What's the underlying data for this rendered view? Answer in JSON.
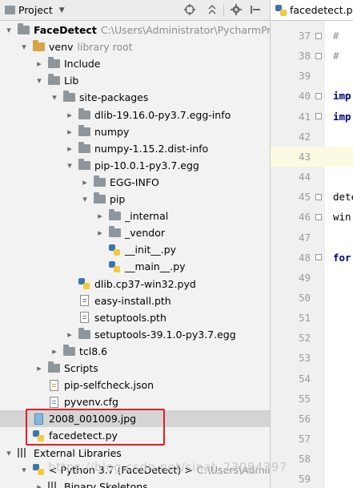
{
  "project_toolbar": {
    "title": "Project",
    "dropdown_glyph": "▼",
    "icons": [
      "target-icon",
      "collapse-all-icon",
      "gear-icon",
      "hide-icon"
    ]
  },
  "tree": [
    {
      "label": "FaceDetect",
      "hint": "C:\\Users\\Administrator\\PycharmProjects",
      "arrow": "▾",
      "icon": "folder",
      "bold": true
    },
    {
      "label": "venv",
      "hint": "library root",
      "arrow": "▾",
      "icon": "folder-lib"
    },
    {
      "label": "Include",
      "hint": "",
      "arrow": "▸",
      "icon": "folder"
    },
    {
      "label": "Lib",
      "hint": "",
      "arrow": "▾",
      "icon": "folder"
    },
    {
      "label": "site-packages",
      "hint": "",
      "arrow": "▾",
      "icon": "folder"
    },
    {
      "label": "dlib-19.16.0-py3.7.egg-info",
      "hint": "",
      "arrow": "▸",
      "icon": "folder"
    },
    {
      "label": "numpy",
      "hint": "",
      "arrow": "▸",
      "icon": "folder"
    },
    {
      "label": "numpy-1.15.2.dist-info",
      "hint": "",
      "arrow": "▸",
      "icon": "folder"
    },
    {
      "label": "pip-10.0.1-py3.7.egg",
      "hint": "",
      "arrow": "▾",
      "icon": "folder"
    },
    {
      "label": "EGG-INFO",
      "hint": "",
      "arrow": "▸",
      "icon": "folder"
    },
    {
      "label": "pip",
      "hint": "",
      "arrow": "▾",
      "icon": "folder"
    },
    {
      "label": "_internal",
      "hint": "",
      "arrow": "▸",
      "icon": "folder"
    },
    {
      "label": "_vendor",
      "hint": "",
      "arrow": "▸",
      "icon": "folder"
    },
    {
      "label": "__init__.py",
      "hint": "",
      "arrow": "",
      "icon": "python"
    },
    {
      "label": "__main__.py",
      "hint": "",
      "arrow": "",
      "icon": "python"
    },
    {
      "label": "dlib.cp37-win32.pyd",
      "hint": "",
      "arrow": "",
      "icon": "python"
    },
    {
      "label": "easy-install.pth",
      "hint": "",
      "arrow": "",
      "icon": "file-pth"
    },
    {
      "label": "setuptools.pth",
      "hint": "",
      "arrow": "",
      "icon": "file-pth"
    },
    {
      "label": "setuptools-39.1.0-py3.7.egg",
      "hint": "",
      "arrow": "▸",
      "icon": "folder"
    },
    {
      "label": "tcl8.6",
      "hint": "",
      "arrow": "▸",
      "icon": "folder"
    },
    {
      "label": "Scripts",
      "hint": "",
      "arrow": "▸",
      "icon": "folder"
    },
    {
      "label": "pip-selfcheck.json",
      "hint": "",
      "arrow": "",
      "icon": "file-json"
    },
    {
      "label": "pyvenv.cfg",
      "hint": "",
      "arrow": "",
      "icon": "file-cfg"
    },
    {
      "label": "2008_001009.jpg",
      "hint": "",
      "arrow": "",
      "icon": "file-image",
      "selected": true
    },
    {
      "label": "facedetect.py",
      "hint": "",
      "arrow": "",
      "icon": "python"
    },
    {
      "label": "External Libraries",
      "hint": "",
      "arrow": "▾",
      "icon": "bars"
    },
    {
      "label": "< Python 3.7 (FaceDetect) >",
      "hint": "C:\\Users\\Administrator",
      "arrow": "▾",
      "icon": "python"
    },
    {
      "label": "Binary Skeletons",
      "hint": "",
      "arrow": "▸",
      "icon": "bars"
    }
  ],
  "editor": {
    "tab_label": "facedetect.py",
    "lines": [
      {
        "num": "37",
        "text": "#",
        "kind": "comment"
      },
      {
        "num": "38",
        "text": "#",
        "kind": "comment"
      },
      {
        "num": "39",
        "text": "",
        "kind": "plain"
      },
      {
        "num": "40",
        "text": "imp",
        "kind": "kw"
      },
      {
        "num": "41",
        "text": "imp",
        "kind": "kw"
      },
      {
        "num": "42",
        "text": "",
        "kind": "plain"
      },
      {
        "num": "43",
        "text": "",
        "kind": "plain",
        "current": true
      },
      {
        "num": "44",
        "text": "",
        "kind": "plain"
      },
      {
        "num": "45",
        "text": "dete",
        "kind": "plain"
      },
      {
        "num": "46",
        "text": "win",
        "kind": "plain"
      },
      {
        "num": "47",
        "text": "",
        "kind": "plain"
      },
      {
        "num": "48",
        "text": "for",
        "kind": "kw"
      },
      {
        "num": "49",
        "text": "",
        "kind": "plain"
      },
      {
        "num": "50",
        "text": "",
        "kind": "plain"
      },
      {
        "num": "51",
        "text": "",
        "kind": "plain"
      },
      {
        "num": "52",
        "text": "",
        "kind": "plain"
      },
      {
        "num": "53",
        "text": "",
        "kind": "plain"
      },
      {
        "num": "54",
        "text": "",
        "kind": "plain"
      },
      {
        "num": "55",
        "text": "",
        "kind": "plain"
      },
      {
        "num": "56",
        "text": "",
        "kind": "plain"
      },
      {
        "num": "57",
        "text": "",
        "kind": "plain"
      },
      {
        "num": "58",
        "text": "",
        "kind": "plain"
      },
      {
        "num": "59",
        "text": "",
        "kind": "plain"
      }
    ]
  },
  "watermark": "https://blog.csdn.net/sinat_23084397"
}
